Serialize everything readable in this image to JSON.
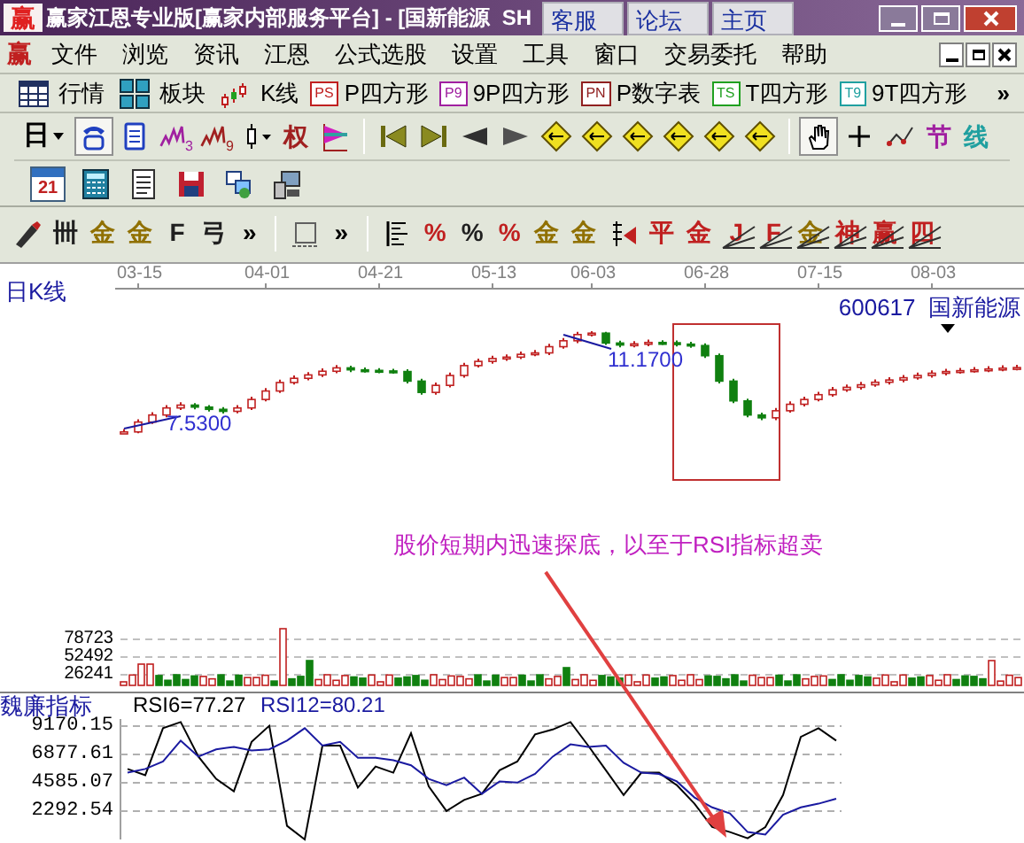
{
  "window": {
    "logo": "赢",
    "title": "赢家江恩专业版[赢家内部服务平台] - [国新能源  SH",
    "links": [
      "客服",
      "论坛",
      "主页"
    ]
  },
  "menu": {
    "logo": "赢",
    "items": [
      "文件",
      "浏览",
      "资讯",
      "江恩",
      "公式选股",
      "设置",
      "工具",
      "窗口",
      "交易委托",
      "帮助"
    ]
  },
  "toolbar": {
    "items": [
      {
        "kind": "grid",
        "label": "行情"
      },
      {
        "kind": "blocks",
        "label": "板块"
      },
      {
        "kind": "candles",
        "label": "K线"
      },
      {
        "kind": "tag",
        "tag": "PS",
        "color": "#c02020",
        "label": "P四方形"
      },
      {
        "kind": "tag",
        "tag": "P9",
        "color": "#a020a0",
        "label": "9P四方形"
      },
      {
        "kind": "tag",
        "tag": "PN",
        "color": "#902020",
        "label": "P数字表"
      },
      {
        "kind": "tag",
        "tag": "TS",
        "color": "#20a020",
        "label": "T四方形"
      },
      {
        "kind": "tag",
        "tag": "T9",
        "color": "#20a0a0",
        "label": "9T四方形"
      }
    ],
    "more": "»"
  },
  "tools_row_1": [
    {
      "kind": "text-dropdown",
      "text": "日",
      "pressed": false
    },
    {
      "kind": "phone",
      "pressed": true
    },
    {
      "kind": "document",
      "pressed": false
    },
    {
      "kind": "wave",
      "sub": "3",
      "color": "#a020a0",
      "pressed": false
    },
    {
      "kind": "wave",
      "sub": "9",
      "color": "#a02020",
      "pressed": false
    },
    {
      "kind": "candle-dropdown",
      "pressed": false
    },
    {
      "kind": "glyph",
      "text": "权",
      "color": "#a02020",
      "pressed": false
    },
    {
      "kind": "flag",
      "pressed": false
    },
    {
      "kind": "separator"
    },
    {
      "kind": "first",
      "pressed": false
    },
    {
      "kind": "last",
      "pressed": false
    },
    {
      "kind": "left",
      "pressed": false
    },
    {
      "kind": "right",
      "pressed": false
    },
    {
      "kind": "diamond",
      "pressed": false
    },
    {
      "kind": "diamond",
      "pressed": false
    },
    {
      "kind": "diamond",
      "pressed": false
    },
    {
      "kind": "diamond",
      "pressed": false
    },
    {
      "kind": "diamond",
      "pressed": false
    },
    {
      "kind": "diamond",
      "pressed": false
    },
    {
      "kind": "separator"
    },
    {
      "kind": "hand",
      "pressed": true
    },
    {
      "kind": "plus",
      "pressed": false
    },
    {
      "kind": "polyline",
      "pressed": false
    },
    {
      "kind": "glyph",
      "text": "节",
      "color": "#a020a0",
      "pressed": false
    },
    {
      "kind": "glyph",
      "text": "线",
      "color": "#20a0a0",
      "pressed": false
    }
  ],
  "tools_row_2": [
    {
      "kind": "calendar",
      "text": "21"
    },
    {
      "kind": "calculator"
    },
    {
      "kind": "notes"
    },
    {
      "kind": "disk"
    },
    {
      "kind": "network"
    },
    {
      "kind": "computer"
    }
  ],
  "tools_row_3_left": [
    {
      "kind": "pen"
    },
    {
      "kind": "glyph",
      "text": "卌",
      "color": "#202020"
    },
    {
      "kind": "glyph",
      "text": "金",
      "color": "#907000"
    },
    {
      "kind": "glyph",
      "text": "金",
      "color": "#907000"
    },
    {
      "kind": "glyph",
      "text": "F",
      "color": "#202020"
    },
    {
      "kind": "glyph",
      "text": "弓",
      "color": "#202020"
    },
    {
      "kind": "more",
      "text": "»"
    },
    {
      "kind": "separator"
    },
    {
      "kind": "frame"
    },
    {
      "kind": "more",
      "text": "»"
    },
    {
      "kind": "separator"
    }
  ],
  "tools_row_3_right": [
    {
      "kind": "list"
    },
    {
      "kind": "glyph",
      "text": "%",
      "color": "#c02020"
    },
    {
      "kind": "glyph",
      "text": "%",
      "color": "#202020"
    },
    {
      "kind": "glyph",
      "text": "%",
      "color": "#c02020"
    },
    {
      "kind": "glyph",
      "text": "金",
      "color": "#907000"
    },
    {
      "kind": "glyph",
      "text": "金",
      "color": "#907000"
    },
    {
      "kind": "drill"
    },
    {
      "kind": "glyph",
      "text": "平",
      "color": "#c02020"
    },
    {
      "kind": "glyph",
      "text": "金",
      "color": "#c02020"
    },
    {
      "kind": "fan",
      "text": "J",
      "color": "#c02020"
    },
    {
      "kind": "fan",
      "text": "F",
      "color": "#c02020"
    },
    {
      "kind": "fan",
      "text": "金",
      "color": "#907000"
    },
    {
      "kind": "fan",
      "text": "神",
      "color": "#c02020"
    },
    {
      "kind": "fan",
      "text": "赢",
      "color": "#c02020"
    },
    {
      "kind": "fan",
      "text": "四",
      "color": "#c02020"
    }
  ],
  "chart": {
    "period": "日K线",
    "stock": "600617  国新能源",
    "price_chart": {
      "chart_data": {
        "type": "candlestick",
        "categories": [
          null,
          "03-15",
          null,
          null,
          null,
          null,
          null,
          null,
          null,
          null,
          "04-01",
          null,
          null,
          null,
          null,
          null,
          null,
          null,
          "04-21",
          null,
          null,
          null,
          null,
          null,
          null,
          null,
          "05-13",
          null,
          null,
          null,
          null,
          null,
          null,
          "06-03",
          null,
          null,
          null,
          null,
          null,
          null,
          null,
          "06-28",
          null,
          null,
          null,
          null,
          null,
          null,
          null,
          "07-15",
          null,
          null,
          null,
          null,
          null,
          null,
          null,
          "08-03",
          null,
          null,
          null,
          null,
          null,
          null
        ],
        "ohlc": [
          [
            7.53,
            7.7,
            7.53,
            7.6
          ],
          [
            7.6,
            8.05,
            7.55,
            7.95
          ],
          [
            7.95,
            8.3,
            7.88,
            8.2
          ],
          [
            8.2,
            8.55,
            8.12,
            8.45
          ],
          [
            8.45,
            8.65,
            8.38,
            8.55
          ],
          [
            8.55,
            8.62,
            8.4,
            8.48
          ],
          [
            8.48,
            8.55,
            8.32,
            8.4
          ],
          [
            8.4,
            8.48,
            8.25,
            8.33
          ],
          [
            8.33,
            8.55,
            8.26,
            8.45
          ],
          [
            8.45,
            8.85,
            8.38,
            8.75
          ],
          [
            8.75,
            9.15,
            8.68,
            9.05
          ],
          [
            9.05,
            9.45,
            8.98,
            9.35
          ],
          [
            9.35,
            9.6,
            9.28,
            9.5
          ],
          [
            9.5,
            9.72,
            9.43,
            9.62
          ],
          [
            9.62,
            9.85,
            9.55,
            9.75
          ],
          [
            9.75,
            9.97,
            9.68,
            9.87
          ],
          [
            9.87,
            9.95,
            9.72,
            9.8
          ],
          [
            9.8,
            9.88,
            9.7,
            9.78
          ],
          [
            9.78,
            9.86,
            9.68,
            9.76
          ],
          [
            9.76,
            9.84,
            9.66,
            9.74
          ],
          [
            9.74,
            9.82,
            9.32,
            9.4
          ],
          [
            9.4,
            9.48,
            8.92,
            9.0
          ],
          [
            9.0,
            9.35,
            8.92,
            9.25
          ],
          [
            9.25,
            9.7,
            9.18,
            9.6
          ],
          [
            9.6,
            10.05,
            9.52,
            9.95
          ],
          [
            9.95,
            10.2,
            9.88,
            10.1
          ],
          [
            10.1,
            10.3,
            10.02,
            10.2
          ],
          [
            10.2,
            10.35,
            10.12,
            10.25
          ],
          [
            10.25,
            10.45,
            10.18,
            10.35
          ],
          [
            10.35,
            10.5,
            10.28,
            10.4
          ],
          [
            10.4,
            10.72,
            10.32,
            10.62
          ],
          [
            10.62,
            10.93,
            10.55,
            10.83
          ],
          [
            10.83,
            11.15,
            10.75,
            11.05
          ],
          [
            11.05,
            11.17,
            10.98,
            11.1
          ],
          [
            11.1,
            11.15,
            10.68,
            10.75
          ],
          [
            10.75,
            10.83,
            10.6,
            10.68
          ],
          [
            10.68,
            10.82,
            10.6,
            10.72
          ],
          [
            10.72,
            10.87,
            10.64,
            10.77
          ],
          [
            10.77,
            10.85,
            10.68,
            10.76
          ],
          [
            10.76,
            10.84,
            10.63,
            10.71
          ],
          [
            10.71,
            10.79,
            10.58,
            10.66
          ],
          [
            10.66,
            10.74,
            10.22,
            10.3
          ],
          [
            10.3,
            10.38,
            9.32,
            9.4
          ],
          [
            9.4,
            9.48,
            8.62,
            8.7
          ],
          [
            8.7,
            8.78,
            8.12,
            8.2
          ],
          [
            8.2,
            8.28,
            8.02,
            8.1
          ],
          [
            8.1,
            8.45,
            8.02,
            8.35
          ],
          [
            8.35,
            8.68,
            8.28,
            8.58
          ],
          [
            8.58,
            8.85,
            8.5,
            8.75
          ],
          [
            8.75,
            9.02,
            8.68,
            8.92
          ],
          [
            8.92,
            9.19,
            8.85,
            9.09
          ],
          [
            9.09,
            9.28,
            9.02,
            9.18
          ],
          [
            9.18,
            9.37,
            9.1,
            9.27
          ],
          [
            9.27,
            9.46,
            9.2,
            9.36
          ],
          [
            9.36,
            9.54,
            9.28,
            9.44
          ],
          [
            9.44,
            9.62,
            9.36,
            9.52
          ],
          [
            9.52,
            9.7,
            9.45,
            9.6
          ],
          [
            9.6,
            9.78,
            9.52,
            9.68
          ],
          [
            9.68,
            9.84,
            9.6,
            9.74
          ],
          [
            9.74,
            9.87,
            9.66,
            9.77
          ],
          [
            9.77,
            9.9,
            9.7,
            9.8
          ],
          [
            9.8,
            9.93,
            9.72,
            9.83
          ],
          [
            9.83,
            9.96,
            9.75,
            9.86
          ],
          [
            9.86,
            9.98,
            9.78,
            9.88
          ]
        ]
      }
    },
    "price_marks": [
      "7.5300",
      "11.1700"
    ],
    "callout": "股价短期内迅速探底，以至于RSI指标超卖",
    "volume_ticks": [
      "78723",
      "52492",
      "26241"
    ],
    "indicator": {
      "name": "魏廉指标",
      "legend": [
        "=77.27",
        "=80.21"
      ],
      "chart_data": {
        "type": "line",
        "grid": true,
        "ylim": [
          0,
          9743
        ],
        "yticks": [
          {
            "value": 9170.15,
            "label": "9170.15"
          },
          {
            "value": 6877.61,
            "label": "6877.61"
          },
          {
            "value": 4585.07,
            "label": "4585.07"
          },
          {
            "value": 2292.54,
            "label": "2292.54"
          }
        ],
        "series": [
          {
            "name": "RSI6",
            "color": "#000000",
            "values": [
              5700,
              5200,
              9000,
              9500,
              6700,
              4900,
              3900,
              7900,
              9200,
              1100,
              0,
              7600,
              7600,
              4200,
              5900,
              5400,
              8600,
              4300,
              2300,
              3200,
              3700,
              5600,
              6300,
              8500,
              8900,
              9500,
              7600,
              5600,
              3600,
              5400,
              5400,
              4400,
              2900,
              1000,
              600,
              100,
              1000,
              3600,
              8300,
              9000,
              8000
            ]
          },
          {
            "name": "RSI12",
            "color": "#1a1aa0",
            "values": [
              5400,
              5700,
              6300,
              8000,
              6700,
              7300,
              7500,
              7200,
              7300,
              8000,
              9000,
              7600,
              7900,
              6600,
              6600,
              6400,
              6000,
              4900,
              4400,
              5000,
              3700,
              4700,
              4600,
              5300,
              6700,
              7700,
              7500,
              7600,
              6200,
              5400,
              5300,
              4700,
              3400,
              2600,
              2100,
              600,
              400,
              2000,
              2600,
              2900,
              3300
            ]
          }
        ]
      }
    }
  }
}
